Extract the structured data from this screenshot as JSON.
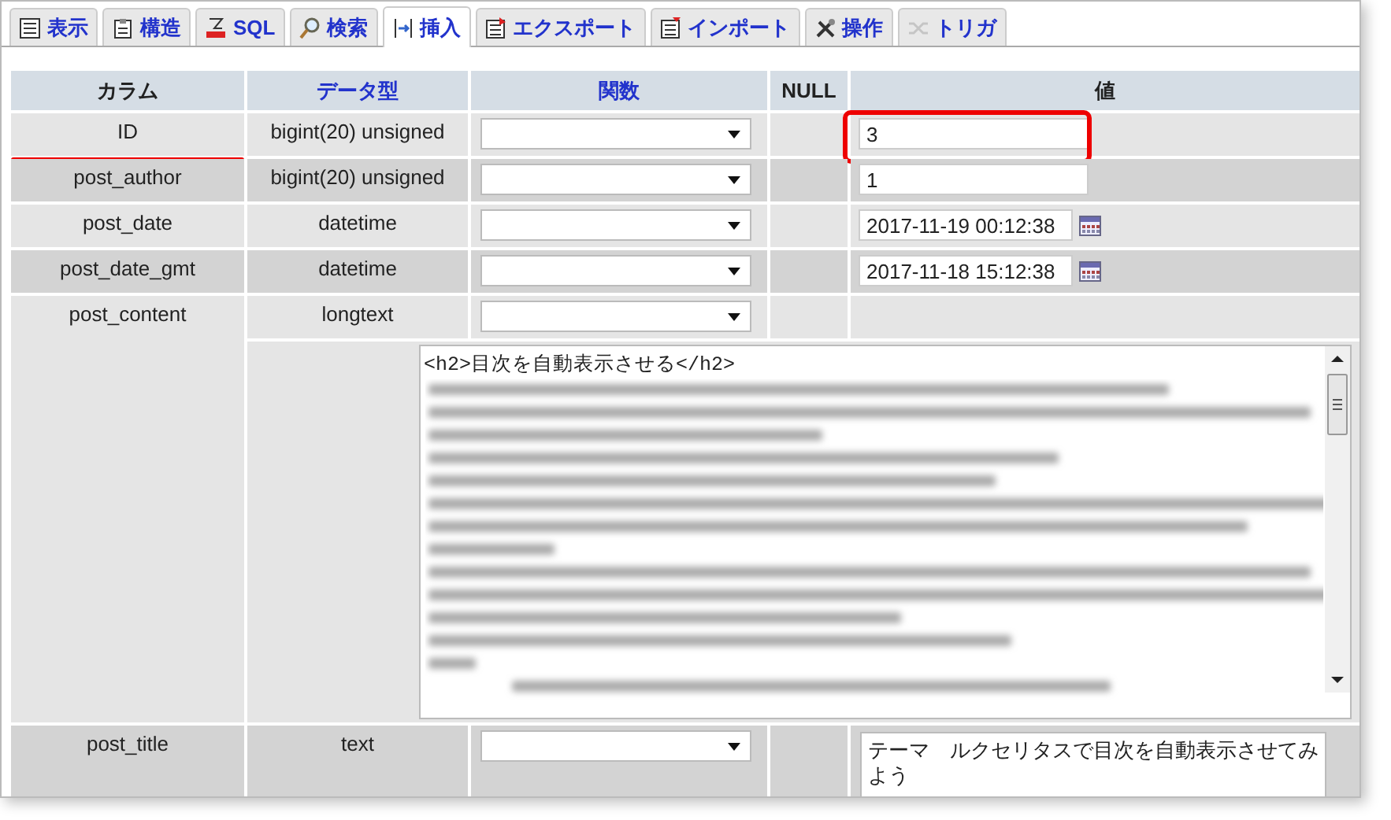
{
  "tabs": [
    {
      "label": "表示",
      "selected": false,
      "disabled": false
    },
    {
      "label": "構造",
      "selected": false,
      "disabled": false
    },
    {
      "label": "SQL",
      "selected": false,
      "disabled": false
    },
    {
      "label": "検索",
      "selected": false,
      "disabled": false
    },
    {
      "label": "挿入",
      "selected": true,
      "disabled": false
    },
    {
      "label": "エクスポート",
      "selected": false,
      "disabled": false
    },
    {
      "label": "インポート",
      "selected": false,
      "disabled": false
    },
    {
      "label": "操作",
      "selected": false,
      "disabled": false
    },
    {
      "label": "トリガ",
      "selected": false,
      "disabled": true
    }
  ],
  "table": {
    "columns": [
      {
        "label": "カラム",
        "kind": "plain"
      },
      {
        "label": "データ型",
        "kind": "link"
      },
      {
        "label": "関数",
        "kind": "link"
      },
      {
        "label": "NULL",
        "kind": "plain"
      },
      {
        "label": "値",
        "kind": "plain"
      }
    ],
    "rows": [
      {
        "name": "ID",
        "type": "bigint(20) unsigned",
        "kind": "text",
        "value": "3",
        "annotated": true
      },
      {
        "name": "post_author",
        "type": "bigint(20) unsigned",
        "kind": "text",
        "value": "1",
        "annotated": false
      },
      {
        "name": "post_date",
        "type": "datetime",
        "kind": "datetime",
        "value": "2017-11-19 00:12:38",
        "annotated": false
      },
      {
        "name": "post_date_gmt",
        "type": "datetime",
        "kind": "datetime",
        "value": "2017-11-18 15:12:38",
        "annotated": false
      },
      {
        "name": "post_content",
        "type": "longtext",
        "kind": "longtext",
        "content": "<h2>目次を自動表示させる</h2>",
        "annotated": false
      },
      {
        "name": "post_title",
        "type": "text",
        "kind": "textarea",
        "value": "テーマ　ルクセリタスで目次を自動表示させてみよう",
        "annotated": false
      }
    ]
  }
}
